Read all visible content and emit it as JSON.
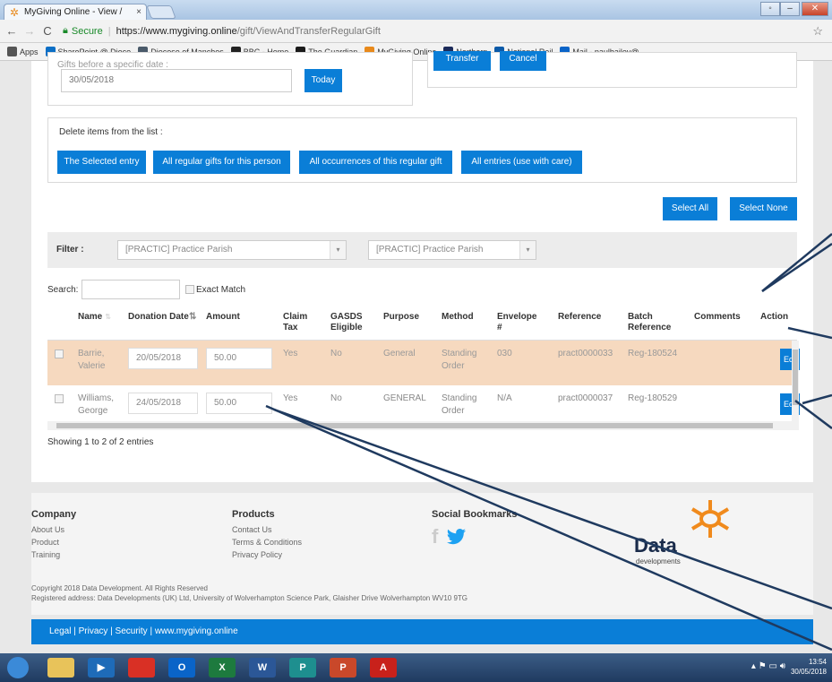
{
  "browser": {
    "tab_title": "MyGiving Online - View / ",
    "tab_close": "×",
    "url_secure": "Secure",
    "url_host": "https://www.mygiving.online",
    "url_path": "/gift/ViewAndTransferRegularGift"
  },
  "bookmarks": [
    {
      "label": "Apps",
      "icon": "apps-icon",
      "color": "#555555"
    },
    {
      "label": "SharePoint @ Dioce",
      "icon": "sharepoint-icon",
      "color": "#0b6fc6"
    },
    {
      "label": "Diocese of Manches",
      "icon": "diocese-icon",
      "color": "#4a5a6a"
    },
    {
      "label": "BBC - Home",
      "icon": "bbc-icon",
      "color": "#222222"
    },
    {
      "label": "The Guardian",
      "icon": "guardian-icon",
      "color": "#1a1a1a"
    },
    {
      "label": "MyGiving Online",
      "icon": "mygiving-icon",
      "color": "#e8891b"
    },
    {
      "label": "Northern",
      "icon": "northern-icon",
      "color": "#1c2b5a"
    },
    {
      "label": "National Rail",
      "icon": "national-rail-icon",
      "color": "#0b5aa8"
    },
    {
      "label": "Mail - paulbailey@",
      "icon": "mail-icon",
      "color": "#0a64c8"
    }
  ],
  "date_section": {
    "partial_label": "Gifts before a specific date :",
    "date_value": "30/05/2018",
    "today_button": "Today",
    "transfer_button": "Transfer",
    "cancel_button": "Cancel"
  },
  "delete_section": {
    "label": "Delete items from the list :",
    "buttons": [
      "The Selected entry",
      "All regular gifts for this person",
      "All occurrences of this regular gift",
      "All entries (use with care)"
    ]
  },
  "selection": {
    "select_all": "Select All",
    "select_none": "Select None"
  },
  "filter": {
    "label": "Filter :",
    "select1": "[PRACTIC] Practice Parish",
    "select2": "[PRACTIC] Practice Parish"
  },
  "search": {
    "label": "Search:",
    "exact_match": "Exact Match"
  },
  "table": {
    "headers": [
      "Name",
      "Donation Date",
      "Amount",
      "Claim Tax",
      "GASDS Eligible",
      "Purpose",
      "Method",
      "Envelope #",
      "Reference",
      "Batch Reference",
      "Comments",
      "Action"
    ],
    "rows": [
      {
        "name": "Barrie, Valerie",
        "date": "20/05/2018",
        "amount": "50.00",
        "claim_tax": "Yes",
        "gasds": "No",
        "purpose": "General",
        "method": "Standing Order",
        "envelope": "030",
        "reference": "pract0000033",
        "batch": "Reg-180524",
        "comments": "",
        "action": "Edit"
      },
      {
        "name": "Williams, George",
        "date": "24/05/2018",
        "amount": "50.00",
        "claim_tax": "Yes",
        "gasds": "No",
        "purpose": "GENERAL",
        "method": "Standing Order",
        "envelope": "N/A",
        "reference": "pract0000037",
        "batch": "Reg-180529",
        "comments": "",
        "action": "Edit"
      }
    ],
    "info": "Showing 1 to 2 of 2 entries"
  },
  "footer": {
    "company_heading": "Company",
    "company_links": [
      "About Us",
      "Product",
      "Training"
    ],
    "products_heading": "Products",
    "products_links": [
      "Contact Us",
      "Terms & Conditions",
      "Privacy Policy"
    ],
    "social_heading": "Social Bookmarks",
    "logo_text": "Data",
    "logo_sub": "developments",
    "copyright": "Copyright 2018 Data Development. All Rights Reserved",
    "address": "Registered address: Data Developments (UK) Ltd, University of Wolverhampton Science Park, Glaisher Drive Wolverhampton WV10 9TG",
    "legal_links": "Legal  |  Privacy  |  Security  |  www.mygiving.online"
  },
  "taskbar": {
    "time": "13:54",
    "date": "30/05/2018",
    "apps": [
      {
        "icon": "start-orb-icon",
        "glyph": "",
        "color": "#3b8ad8"
      },
      {
        "icon": "file-explorer-icon",
        "glyph": "",
        "color": "#e8c35a"
      },
      {
        "icon": "media-player-icon",
        "glyph": "▶",
        "color": "#1e6bb8"
      },
      {
        "icon": "chrome-icon",
        "glyph": "",
        "color": "#d93025"
      },
      {
        "icon": "outlook-icon",
        "glyph": "O",
        "color": "#0a64c8"
      },
      {
        "icon": "excel-icon",
        "glyph": "X",
        "color": "#1d7a3e"
      },
      {
        "icon": "word-icon",
        "glyph": "W",
        "color": "#2b5797"
      },
      {
        "icon": "publisher-icon",
        "glyph": "P",
        "color": "#1e8f8f"
      },
      {
        "icon": "powerpoint-icon",
        "glyph": "P",
        "color": "#c9482a"
      },
      {
        "icon": "acrobat-icon",
        "glyph": "A",
        "color": "#c8211b"
      }
    ]
  }
}
